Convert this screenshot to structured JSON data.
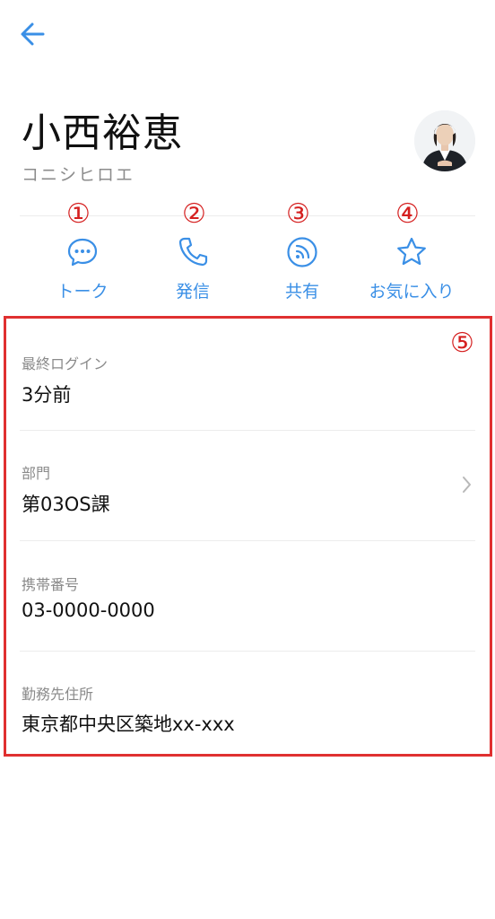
{
  "header": {
    "back_icon": "arrow-left-icon"
  },
  "profile": {
    "name": "小西裕恵",
    "kana": "コニシヒロエ"
  },
  "markers": [
    "①",
    "②",
    "③",
    "④",
    "⑤"
  ],
  "actions": [
    {
      "label": "トーク",
      "icon": "chat-bubble-icon"
    },
    {
      "label": "発信",
      "icon": "phone-icon"
    },
    {
      "label": "共有",
      "icon": "share-feed-icon"
    },
    {
      "label": "お気に入り",
      "icon": "star-icon"
    }
  ],
  "fields": [
    {
      "label": "最終ログイン",
      "value": "3分前"
    },
    {
      "label": "部門",
      "value": "第03OS課"
    },
    {
      "label": "携帯番号",
      "value": "03-0000-0000"
    },
    {
      "label": "勤務先住所",
      "value": "東京都中央区築地xx-xxx"
    }
  ],
  "colors": {
    "accent": "#3a8fe6",
    "annotation": "#e03030"
  }
}
